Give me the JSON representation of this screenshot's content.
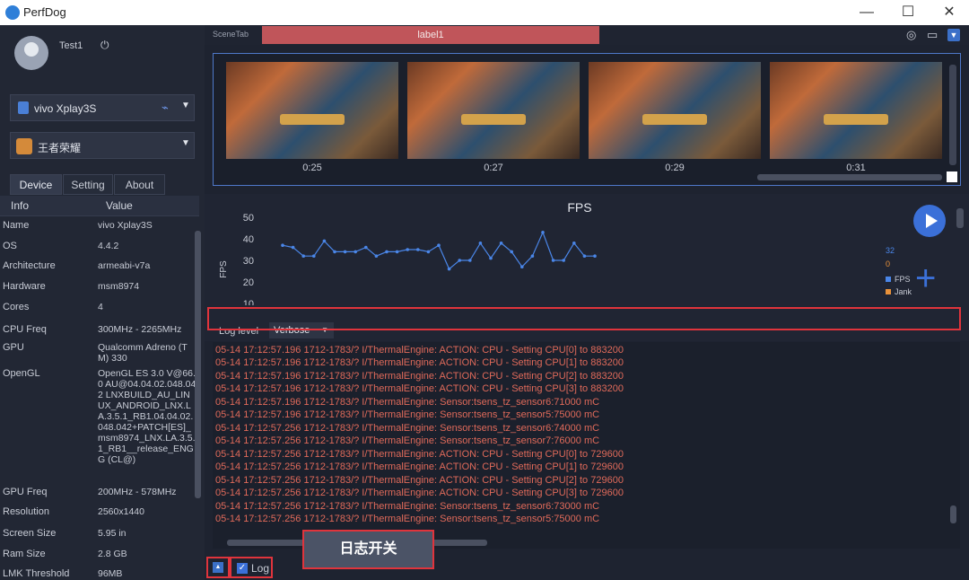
{
  "window": {
    "title": "PerfDog",
    "minimize": "—",
    "maximize": "☐",
    "close": "✕"
  },
  "user": {
    "name": "Test1",
    "power_icon": "power-icon"
  },
  "device_select": {
    "label": "vivo Xplay3S",
    "icon": "android-icon",
    "usb_icon": "usb-icon"
  },
  "app_select": {
    "label": "王者荣耀",
    "icon": "game-icon"
  },
  "tabs": [
    "Device",
    "Setting",
    "About"
  ],
  "active_tab": "Device",
  "info_table": {
    "headers": [
      "Info",
      "Value"
    ],
    "rows": [
      {
        "k": "Name",
        "v": "vivo Xplay3S"
      },
      {
        "k": "OS",
        "v": "4.4.2"
      },
      {
        "k": "Architecture",
        "v": "armeabi-v7a"
      },
      {
        "k": "Hardware",
        "v": "msm8974"
      },
      {
        "k": "Cores",
        "v": "4"
      },
      {
        "k": "CPU Freq",
        "v": "300MHz - 2265MHz"
      },
      {
        "k": "GPU",
        "v": "Qualcomm Adreno (TM) 330"
      },
      {
        "k": "OpenGL",
        "v": "OpenGL ES 3.0 V@66.0 AU@04.04.02.048.042 LNXBUILD_AU_LINUX_ANDROID_LNX.LA.3.5.1_RB1.04.04.02.048.042+PATCH[ES]_msm8974_LNX.LA.3.5.1_RB1__release_ENGG (CL@)"
      },
      {
        "k": "GPU Freq",
        "v": "200MHz - 578MHz"
      },
      {
        "k": "Resolution",
        "v": "2560x1440"
      },
      {
        "k": "Screen Size",
        "v": "5.95 in"
      },
      {
        "k": "Ram Size",
        "v": "2.8 GB"
      },
      {
        "k": "LMK Threshold",
        "v": "96MB"
      }
    ]
  },
  "scene_tab": {
    "label": "SceneTab",
    "active": "label1",
    "icons": [
      "location-icon",
      "folder-icon",
      "dropdown-icon"
    ]
  },
  "thumbnails": {
    "times": [
      "0:25",
      "0:27",
      "0:29",
      "0:31"
    ]
  },
  "fps_chart": {
    "title": "FPS",
    "ylabel": "FPS",
    "yticks": [
      "50",
      "40",
      "30",
      "20",
      "10"
    ],
    "current_fps": "32",
    "current_jank": "0",
    "legend": [
      {
        "name": "FPS",
        "color": "#4a86e8"
      },
      {
        "name": "Jank",
        "color": "#e8913a"
      }
    ],
    "play_icon": "play-icon",
    "add_icon": "plus-icon"
  },
  "chart_data": {
    "type": "line",
    "title": "FPS",
    "xlabel": "",
    "ylabel": "FPS",
    "ylim": [
      10,
      50
    ],
    "series": [
      {
        "name": "FPS",
        "values": [
          37,
          36,
          32,
          32,
          39,
          34,
          34,
          34,
          36,
          32,
          34,
          34,
          35,
          35,
          34,
          37,
          26,
          30,
          30,
          38,
          31,
          38,
          34,
          27,
          32,
          43,
          30,
          30,
          38,
          32,
          32
        ]
      }
    ]
  },
  "log": {
    "level_label": "Log level",
    "level_value": "Verbose",
    "lines": [
      "05-14 17:12:57.196 1712-1783/? I/ThermalEngine: ACTION: CPU - Setting CPU[0] to 883200",
      "05-14 17:12:57.196 1712-1783/? I/ThermalEngine: ACTION: CPU - Setting CPU[1] to 883200",
      "05-14 17:12:57.196 1712-1783/? I/ThermalEngine: ACTION: CPU - Setting CPU[2] to 883200",
      "05-14 17:12:57.196 1712-1783/? I/ThermalEngine: ACTION: CPU - Setting CPU[3] to 883200",
      "05-14 17:12:57.196 1712-1783/? I/ThermalEngine: Sensor:tsens_tz_sensor6:71000 mC",
      "05-14 17:12:57.196 1712-1783/? I/ThermalEngine: Sensor:tsens_tz_sensor5:75000 mC",
      "05-14 17:12:57.256 1712-1783/? I/ThermalEngine: Sensor:tsens_tz_sensor6:74000 mC",
      "05-14 17:12:57.256 1712-1783/? I/ThermalEngine: Sensor:tsens_tz_sensor7:76000 mC",
      "05-14 17:12:57.256 1712-1783/? I/ThermalEngine: ACTION: CPU - Setting CPU[0] to 729600",
      "05-14 17:12:57.256 1712-1783/? I/ThermalEngine: ACTION: CPU - Setting CPU[1] to 729600",
      "05-14 17:12:57.256 1712-1783/? I/ThermalEngine: ACTION: CPU - Setting CPU[2] to 729600",
      "05-14 17:12:57.256 1712-1783/? I/ThermalEngine: ACTION: CPU - Setting CPU[3] to 729600",
      "05-14 17:12:57.256 1712-1783/? I/ThermalEngine: Sensor:tsens_tz_sensor6:73000 mC",
      "05-14 17:12:57.256 1712-1783/? I/ThermalEngine: Sensor:tsens_tz_sensor5:75000 mC"
    ],
    "log_checkbox_label": "Log",
    "log_checked": true,
    "expand_icon": "expand-up-icon"
  },
  "annotation": {
    "callout": "日志开关"
  }
}
